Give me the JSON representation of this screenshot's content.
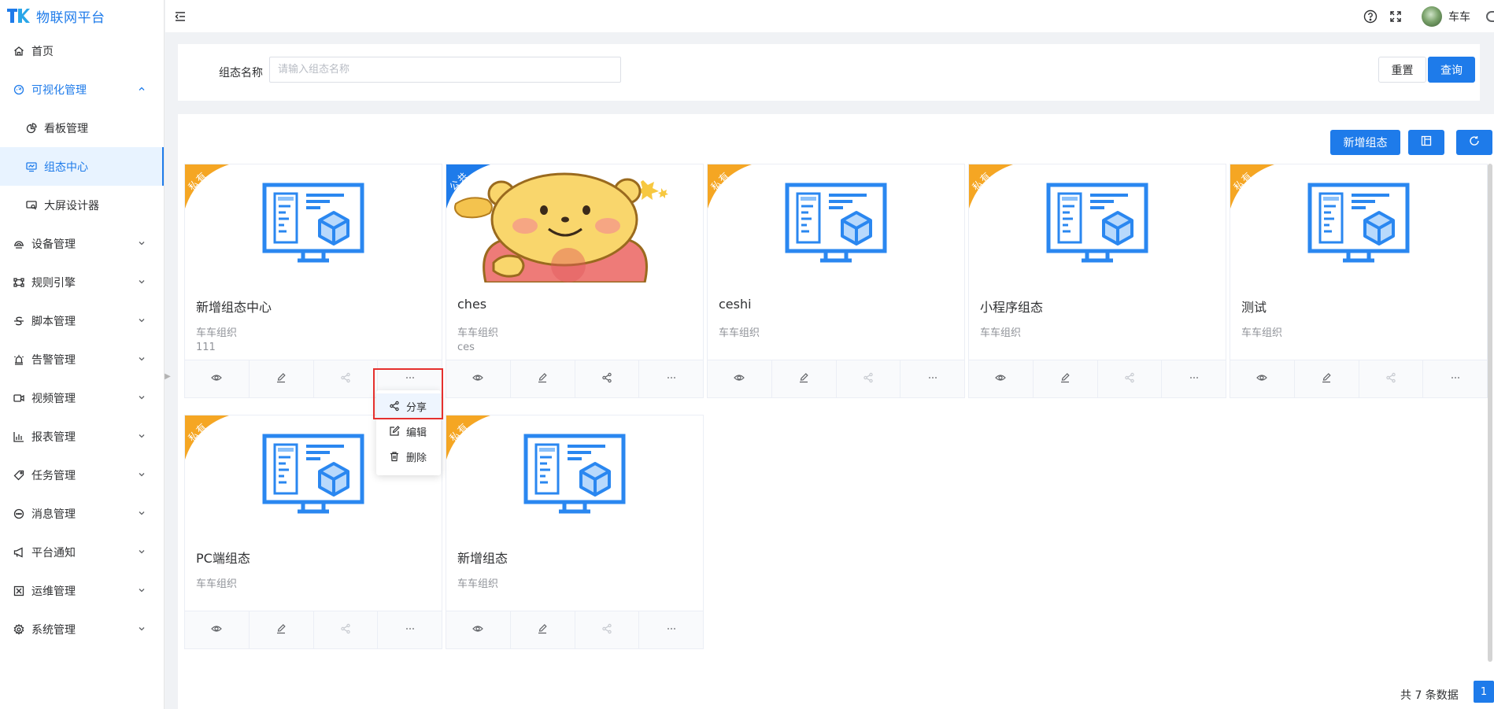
{
  "app": {
    "title": "物联网平台"
  },
  "sidebar": {
    "items": [
      {
        "label": "首页",
        "icon": "home-icon"
      },
      {
        "label": "可视化管理",
        "icon": "dashboard-icon",
        "open": true,
        "children": [
          {
            "label": "看板管理",
            "icon": "pie-chart-icon"
          },
          {
            "label": "组态中心",
            "icon": "monitor-icon",
            "active": true
          },
          {
            "label": "大屏设计器",
            "icon": "screen-designer-icon"
          }
        ]
      },
      {
        "label": "设备管理",
        "icon": "device-icon"
      },
      {
        "label": "规则引擎",
        "icon": "rule-icon"
      },
      {
        "label": "脚本管理",
        "icon": "script-icon"
      },
      {
        "label": "告警管理",
        "icon": "alarm-icon"
      },
      {
        "label": "视频管理",
        "icon": "video-icon"
      },
      {
        "label": "报表管理",
        "icon": "report-icon"
      },
      {
        "label": "任务管理",
        "icon": "task-icon"
      },
      {
        "label": "消息管理",
        "icon": "message-icon"
      },
      {
        "label": "平台通知",
        "icon": "notice-icon"
      },
      {
        "label": "运维管理",
        "icon": "ops-icon"
      },
      {
        "label": "系统管理",
        "icon": "settings-icon"
      }
    ]
  },
  "header": {
    "username": "车车"
  },
  "search": {
    "label": "组态名称",
    "placeholder": "请输入组态名称",
    "reset_label": "重置",
    "query_label": "查询"
  },
  "toolbar": {
    "add_label": "新增组态"
  },
  "cards": [
    {
      "title": "新增组态中心",
      "org": "车车组织",
      "desc": "111",
      "badge": "私有",
      "badge_color": "#f5a623",
      "image": "scada"
    },
    {
      "title": "ches",
      "org": "车车组织",
      "desc": "ces",
      "badge": "公共",
      "badge_color": "#1e7bea",
      "image": "bear"
    },
    {
      "title": "ceshi",
      "org": "车车组织",
      "desc": "",
      "badge": "私有",
      "badge_color": "#f5a623",
      "image": "scada"
    },
    {
      "title": "小程序组态",
      "org": "车车组织",
      "desc": "",
      "badge": "私有",
      "badge_color": "#f5a623",
      "image": "scada"
    },
    {
      "title": "测试",
      "org": "车车组织",
      "desc": "",
      "badge": "私有",
      "badge_color": "#f5a623",
      "image": "scada"
    },
    {
      "title": "PC端组态",
      "org": "车车组织",
      "desc": "",
      "badge": "私有",
      "badge_color": "#f5a623",
      "image": "scada"
    },
    {
      "title": "新增组态",
      "org": "车车组织",
      "desc": "",
      "badge": "私有",
      "badge_color": "#f5a623",
      "image": "scada"
    }
  ],
  "dropdown": {
    "items": [
      {
        "label": "分享",
        "icon": "share-icon"
      },
      {
        "label": "编辑",
        "icon": "edit-icon"
      },
      {
        "label": "删除",
        "icon": "delete-icon"
      }
    ]
  },
  "pagination": {
    "total_text": "共 7 条数据",
    "current_page": "1"
  },
  "colors": {
    "primary": "#1e7bea",
    "private": "#f5a623",
    "public": "#1e7bea"
  }
}
